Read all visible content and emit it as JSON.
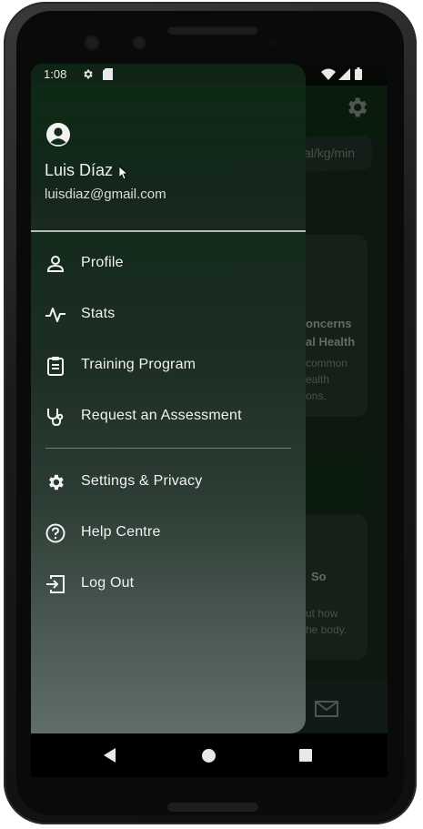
{
  "status_bar": {
    "time": "1:08",
    "icons": [
      "settings-icon",
      "sim-icon",
      "wifi-icon",
      "signal-icon",
      "battery-icon"
    ]
  },
  "background_app": {
    "snippet_unit": "al/kg/min",
    "card_title_line1": "oncerns",
    "card_title_line2": "al Health",
    "card_text_line1": "common",
    "card_text_line2": "ealth",
    "card_text_line3": "ons.",
    "card2_title": "So",
    "card2_text_line1": "ut how",
    "card2_text_line2": "he body."
  },
  "drawer": {
    "user_name": "Luis Díaz",
    "user_email": "luisdiaz@gmail.com",
    "items": [
      {
        "label": "Profile",
        "icon": "person-icon"
      },
      {
        "label": "Stats",
        "icon": "activity-icon"
      },
      {
        "label": "Training Program",
        "icon": "clipboard-icon"
      },
      {
        "label": "Request an Assessment",
        "icon": "stethoscope-icon"
      }
    ],
    "secondary_items": [
      {
        "label": "Settings & Privacy",
        "icon": "gear-icon"
      },
      {
        "label": "Help Centre",
        "icon": "help-icon"
      },
      {
        "label": "Log Out",
        "icon": "logout-icon"
      }
    ]
  },
  "colors": {
    "app_bar": "#0e2a11",
    "drawer_top": "#0f2416",
    "drawer_bottom": "#5f6e67",
    "text": "#f2f2f2"
  }
}
